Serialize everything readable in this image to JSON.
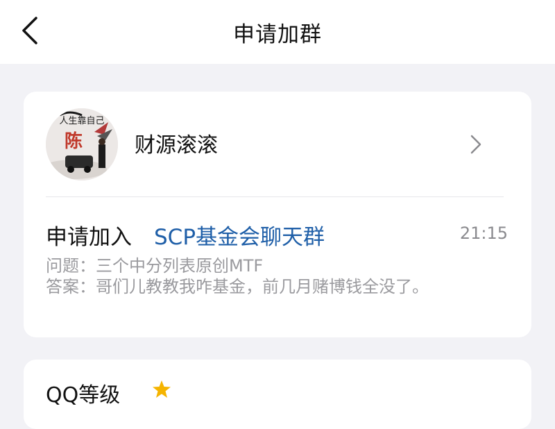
{
  "header": {
    "title": "申请加群",
    "back_icon": "chevron-left-icon"
  },
  "applicant": {
    "name": "财源滚滚",
    "avatar_text_top": "人生靠自己",
    "avatar_text_center": "陈",
    "chevron_icon": "chevron-right-icon"
  },
  "request": {
    "action_label": "申请加入",
    "group_name": "SCP基金会聊天群",
    "time": "21:15",
    "question": "问题：三个中分列表原创MTF",
    "answer": "答案：哥们儿教教我咋基金，前几月赌博钱全没了。"
  },
  "qq_level": {
    "label": "QQ等级",
    "badge_icon": "star-icon",
    "badge_color": "#f5b400"
  },
  "colors": {
    "group_link": "#1f5fa8",
    "secondary_text": "#9a9a9e",
    "background": "#f2f2f6"
  }
}
